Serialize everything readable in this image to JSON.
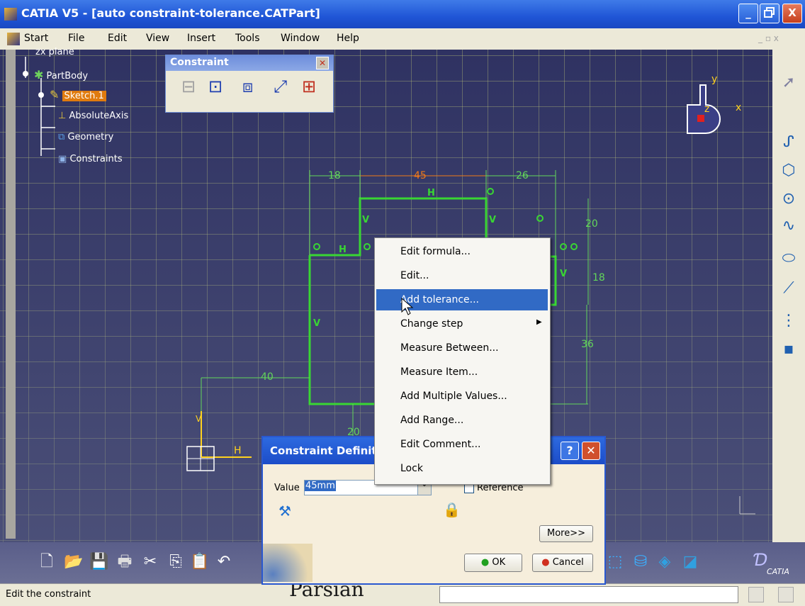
{
  "window": {
    "title": "CATIA V5 - [auto constraint-tolerance.CATPart]",
    "min": "_",
    "restore": "▫",
    "close": "X"
  },
  "menubar": {
    "items": [
      "Start",
      "File",
      "Edit",
      "View",
      "Insert",
      "Tools",
      "Window",
      "Help"
    ]
  },
  "tree": {
    "plane": "zx plane",
    "partbody": "PartBody",
    "sketch": "Sketch.1",
    "absaxis": "AbsoluteAxis",
    "geometry": "Geometry",
    "constraints": "Constraints"
  },
  "constraint_toolbar": {
    "title": "Constraint"
  },
  "compass": {
    "x": "x",
    "y": "y",
    "z": "z"
  },
  "sketch": {
    "dim_18_top": "18",
    "dim_45": "45",
    "dim_26": "26",
    "dim_20_right": "20",
    "dim_18_right": "18",
    "dim_36": "36",
    "dim_40": "40",
    "dim_20_bottom": "20",
    "axis_v": "V",
    "axis_h": "H"
  },
  "context_menu": {
    "items": [
      "Edit formula...",
      "Edit...",
      "Add tolerance...",
      "Change step",
      "Measure Between...",
      "Measure Item...",
      "Add Multiple Values...",
      "Add Range...",
      "Edit Comment...",
      "Lock"
    ],
    "highlighted": "Add tolerance..."
  },
  "dialog": {
    "title": "Constraint Definiti",
    "value_label": "Value",
    "value": "45mm",
    "reference_label": "Reference",
    "more_button": "More>>",
    "ok_button": "OK",
    "cancel_button": "Cancel"
  },
  "statusbar": {
    "text": "Edit the constraint"
  },
  "watermark": "Parsian",
  "catia_logo": "CATIA",
  "colors": {
    "sketch_green": "#39d633",
    "dim_green": "#63d65a",
    "selected_dim": "#f07a19",
    "highlight": "#316ac5"
  }
}
